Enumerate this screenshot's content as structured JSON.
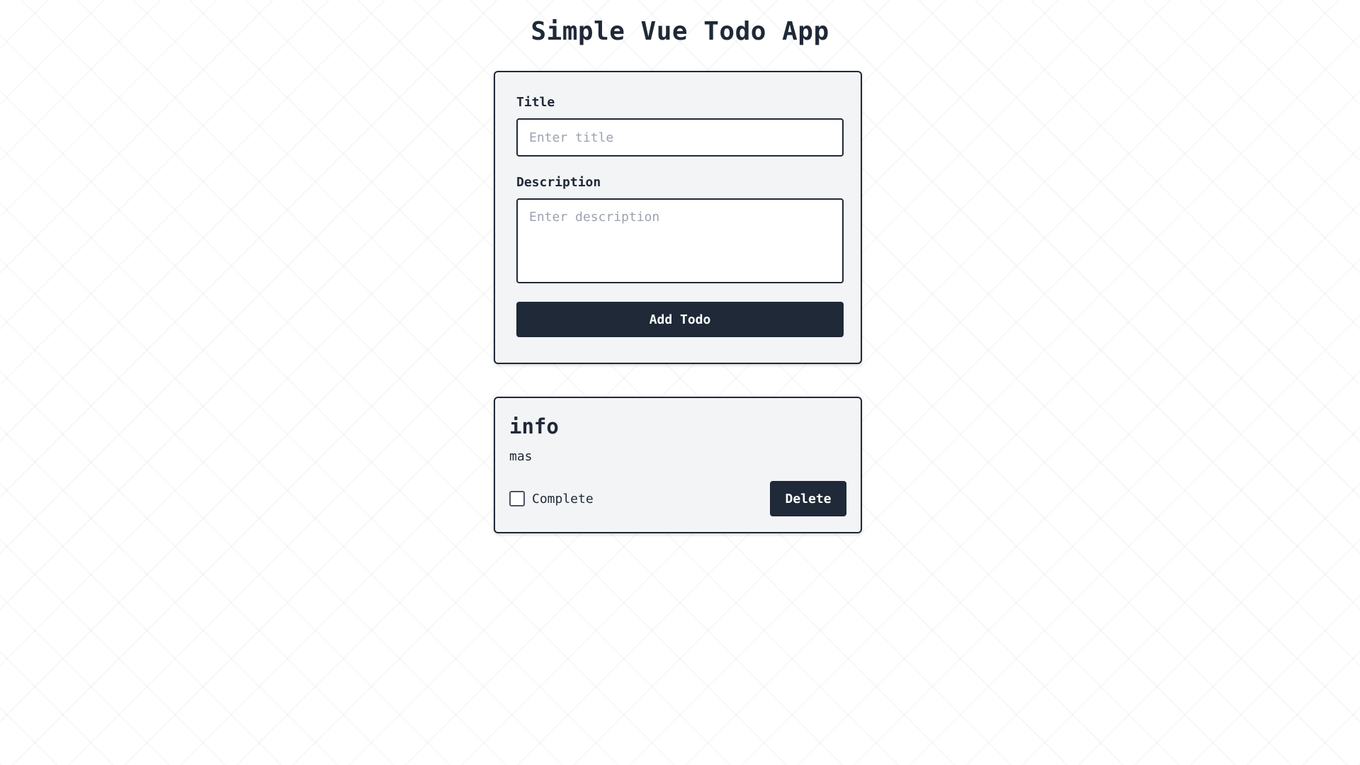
{
  "app": {
    "title": "Simple Vue Todo App"
  },
  "form": {
    "title_label": "Title",
    "title_value": "",
    "title_placeholder": "Enter title",
    "description_label": "Description",
    "description_value": "",
    "description_placeholder": "Enter description",
    "submit_label": "Add Todo"
  },
  "todos": [
    {
      "title": "info",
      "description": "mas",
      "complete_label": "Complete",
      "completed": false,
      "delete_label": "Delete"
    }
  ],
  "colors": {
    "primary": "#1f2937",
    "card_background": "#f3f4f6",
    "placeholder": "#9ca3af",
    "page_background": "#ffffff"
  }
}
